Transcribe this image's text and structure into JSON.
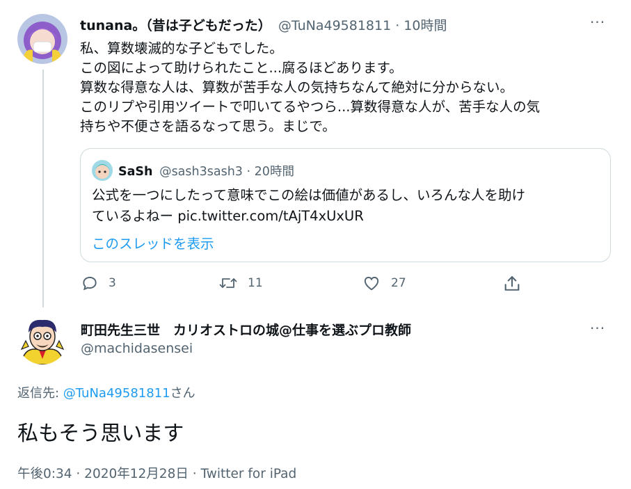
{
  "tweet": {
    "display_name": "tunana。（昔は子どもだった）",
    "handle": "@TuNa49581811",
    "separator": "·",
    "time_ago": "10時間",
    "more": "···",
    "lines": [
      "私、算数壊滅的な子どもでした。",
      "この図によって助けられたこと...腐るほどあります。",
      "算数な得意な人は、算数が苦手な人の気持ちなんて絶対に分からない。",
      "このリプや引用ツイートで叩いてるやつら...算数得意な人が、苦手な人の気",
      "持ちや不便さを語るなって思う。まじで。"
    ],
    "quote": {
      "display_name": "SaSh",
      "handle": "@sash3sash3",
      "separator": "·",
      "time_ago": "20時間",
      "lines": [
        "公式を一つにしたって意味でこの絵は価値があるし、いろんな人を助け",
        "ているよねー pic.twitter.com/tAjT4xUxUR"
      ],
      "show_thread": "このスレッドを表示"
    },
    "actions": {
      "replies": "3",
      "retweets": "11",
      "likes": "27"
    }
  },
  "reply": {
    "display_name": "町田先生三世　カリオストロの城@仕事を選ぶプロ教師",
    "handle": "@machidasensei",
    "more": "···",
    "reply_to_prefix": "返信先: ",
    "reply_to_handle": "@TuNa49581811",
    "reply_to_suffix": "さん",
    "text": "私もそう思います",
    "timestamp": "午後0:34 · 2020年12月28日 · Twitter for iPad"
  }
}
